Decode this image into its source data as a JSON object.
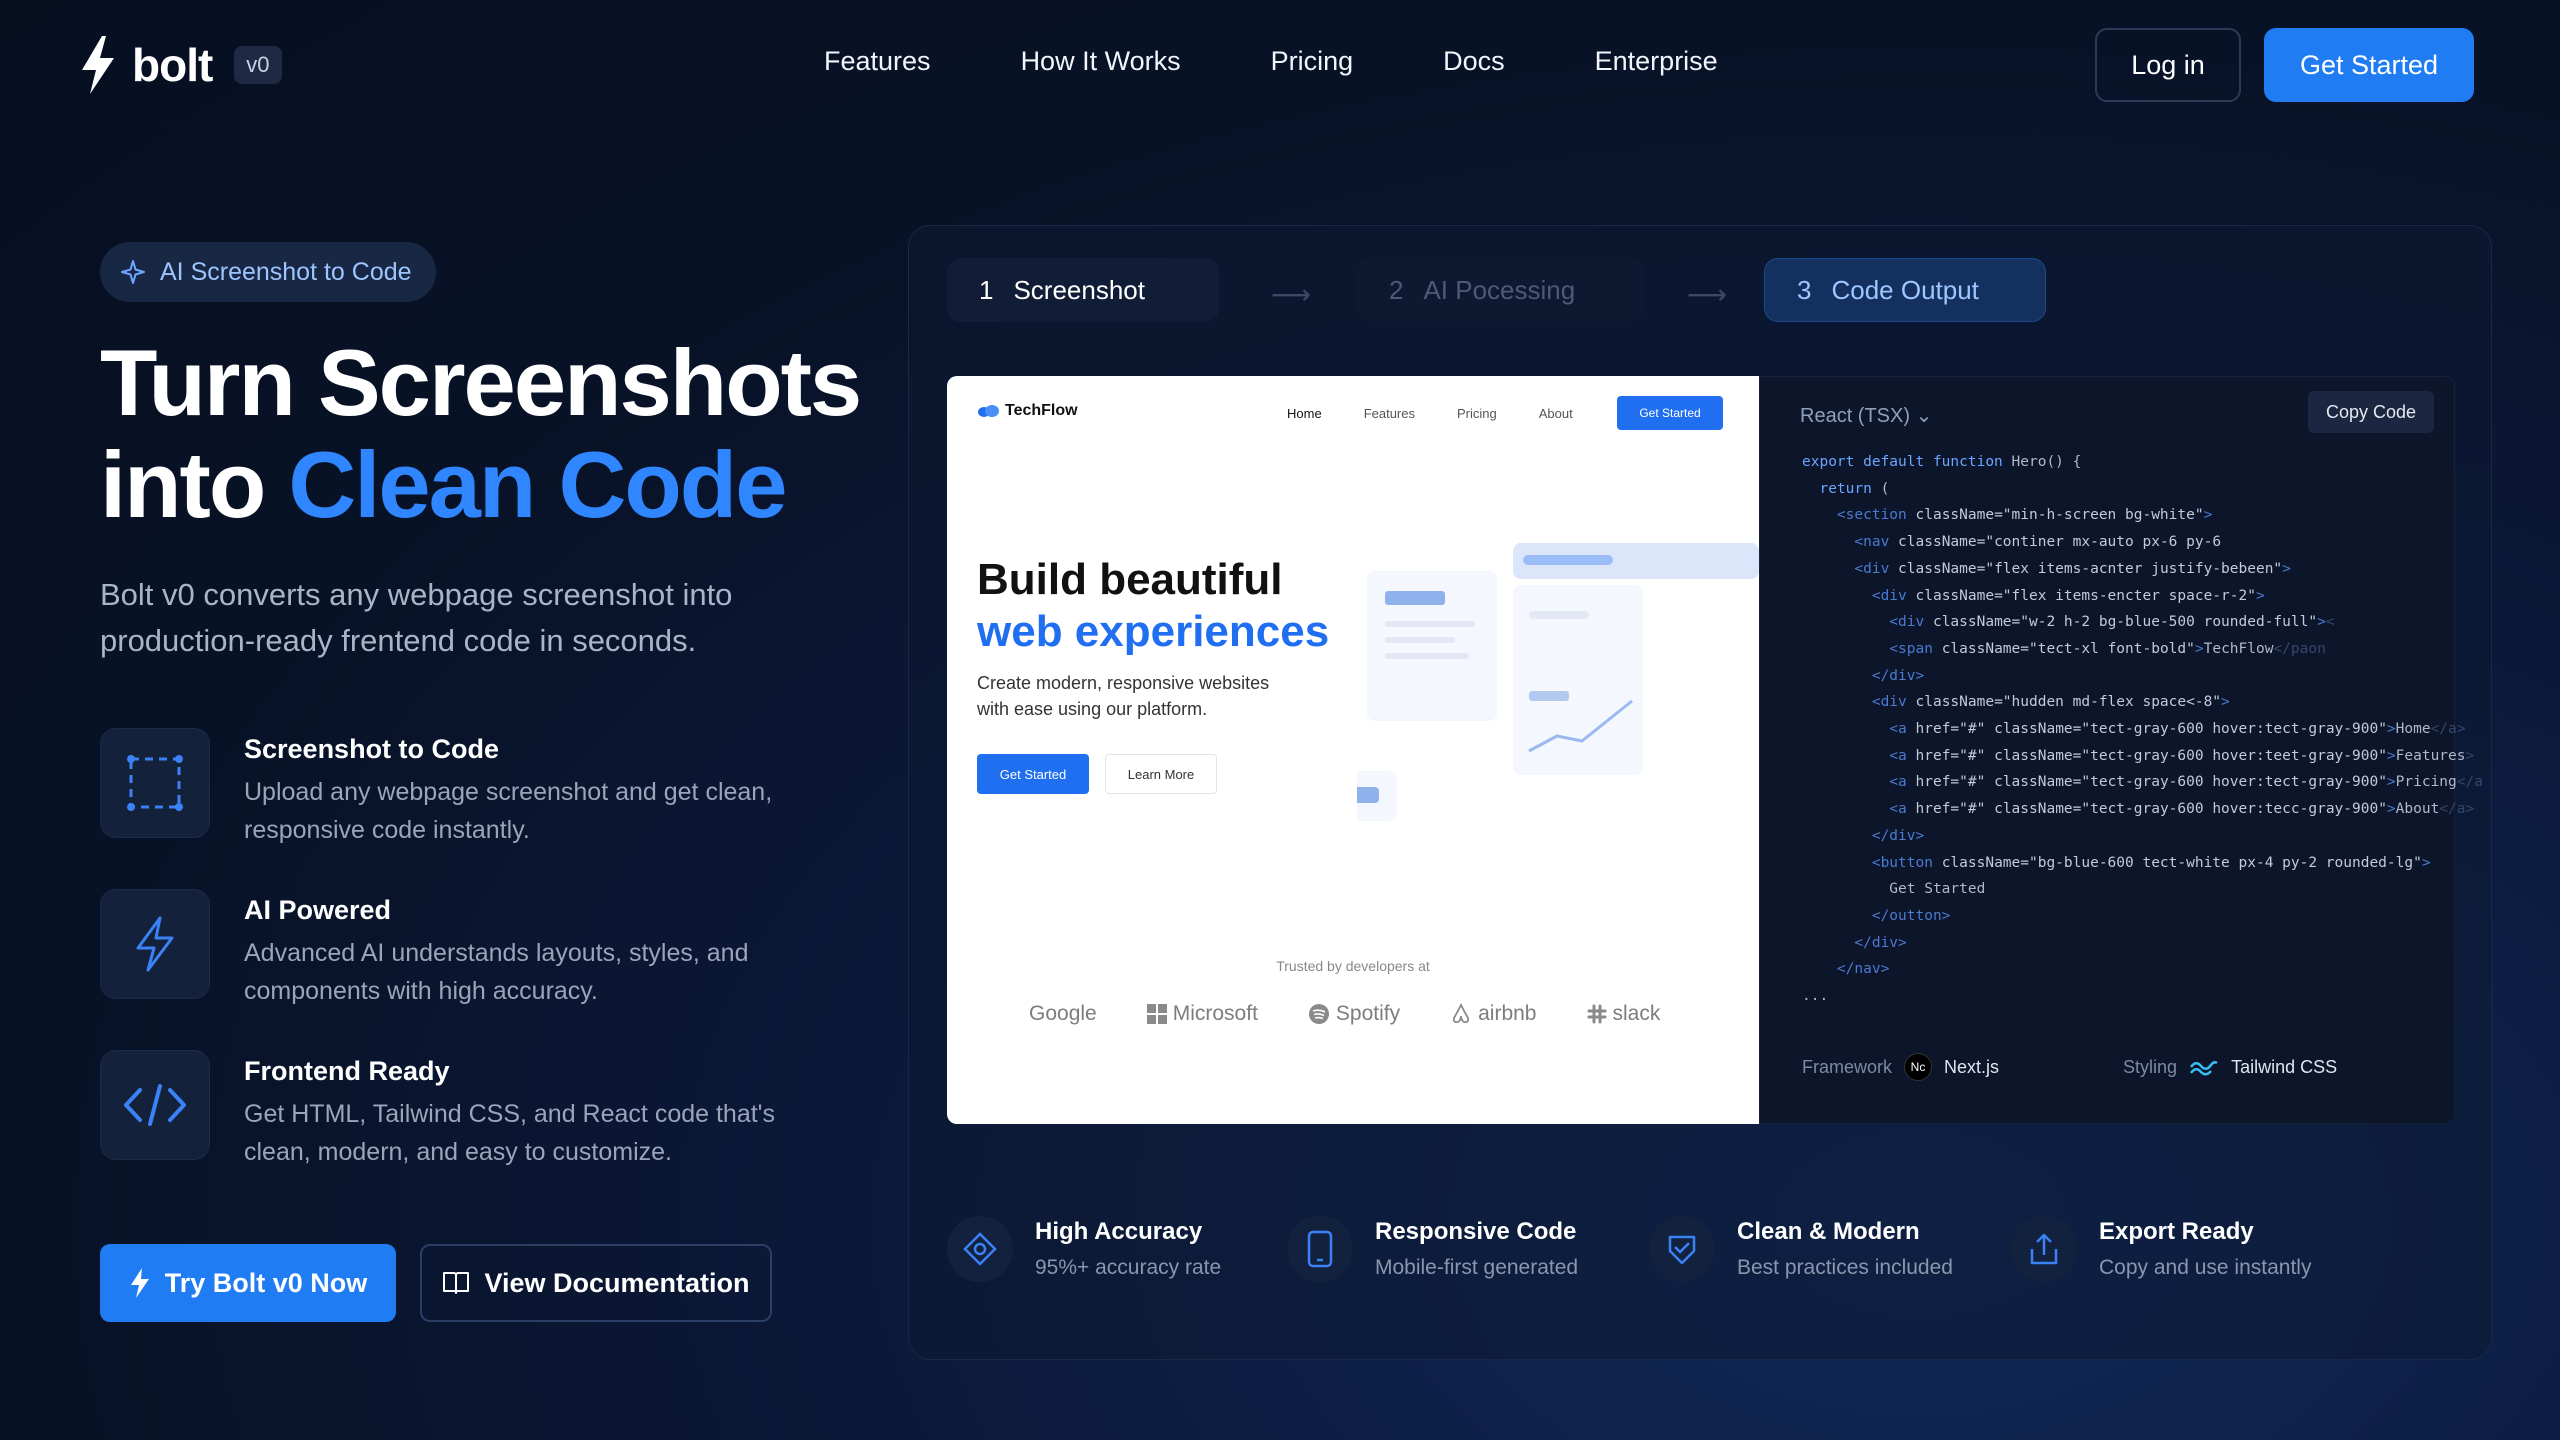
{
  "brand": {
    "name": "bolt",
    "version": "v0"
  },
  "nav": {
    "links": [
      "Features",
      "How It Works",
      "Pricing",
      "Docs",
      "Enterprise"
    ],
    "login": "Log in",
    "cta": "Get Started"
  },
  "hero": {
    "pill": "AI Screenshot to Code",
    "title_line1": "Turn Screenshots",
    "title_line2_prefix": "into ",
    "title_line2_accent": "Clean Code",
    "subtitle": "Bolt v0 converts any webpage screenshot into production-ready frentend code in seconds.",
    "features": [
      {
        "title": "Screenshot to Code",
        "desc": "Upload any webpage screenshot and get clean, responsive code instantly."
      },
      {
        "title": "AI Powered",
        "desc": "Advanced AI understands layouts, styles, and components with high accuracy."
      },
      {
        "title": "Frontend Ready",
        "desc": "Get HTML, Tailwind CSS, and React code that's clean, modern, and easy to customize."
      }
    ],
    "try_button": "Try Bolt v0 Now",
    "docs_button": "View Documentation"
  },
  "steps": [
    {
      "num": "1",
      "label": "Screenshot"
    },
    {
      "num": "2",
      "label": "AI Pocessing"
    },
    {
      "num": "3",
      "label": "Code Output"
    }
  ],
  "preview": {
    "logo": "TechFlow",
    "nav": [
      "Home",
      "Features",
      "Pricing",
      "About"
    ],
    "cta": "Get Started",
    "heading1": "Build beautiful",
    "heading2": "web experiences",
    "text": "Create modern, responsive websites with ease using our platform.",
    "btn_primary": "Get Started",
    "btn_secondary": "Learn More",
    "trusted": "Trusted by developers at",
    "logos": [
      "Google",
      "Microsoft",
      "Spotify",
      "airbnb",
      "slack"
    ]
  },
  "code": {
    "language": "React (TSX)",
    "copy": "Copy Code",
    "framework_label": "Framework",
    "framework_value": "Next.js",
    "framework_badge": "Nc",
    "styling_label": "Styling",
    "styling_value": "Tailwind CSS"
  },
  "benefits": [
    {
      "title": "High Accuracy",
      "desc": "95%+ accuracy rate"
    },
    {
      "title": "Responsive Code",
      "desc": "Mobile-first generated"
    },
    {
      "title": "Clean & Modern",
      "desc": "Best practices included"
    },
    {
      "title": "Export Ready",
      "desc": "Copy and use instantly"
    }
  ],
  "colors": {
    "accent": "#1f7cf2",
    "bg": "#081226",
    "accent_text": "#2f86ff"
  }
}
